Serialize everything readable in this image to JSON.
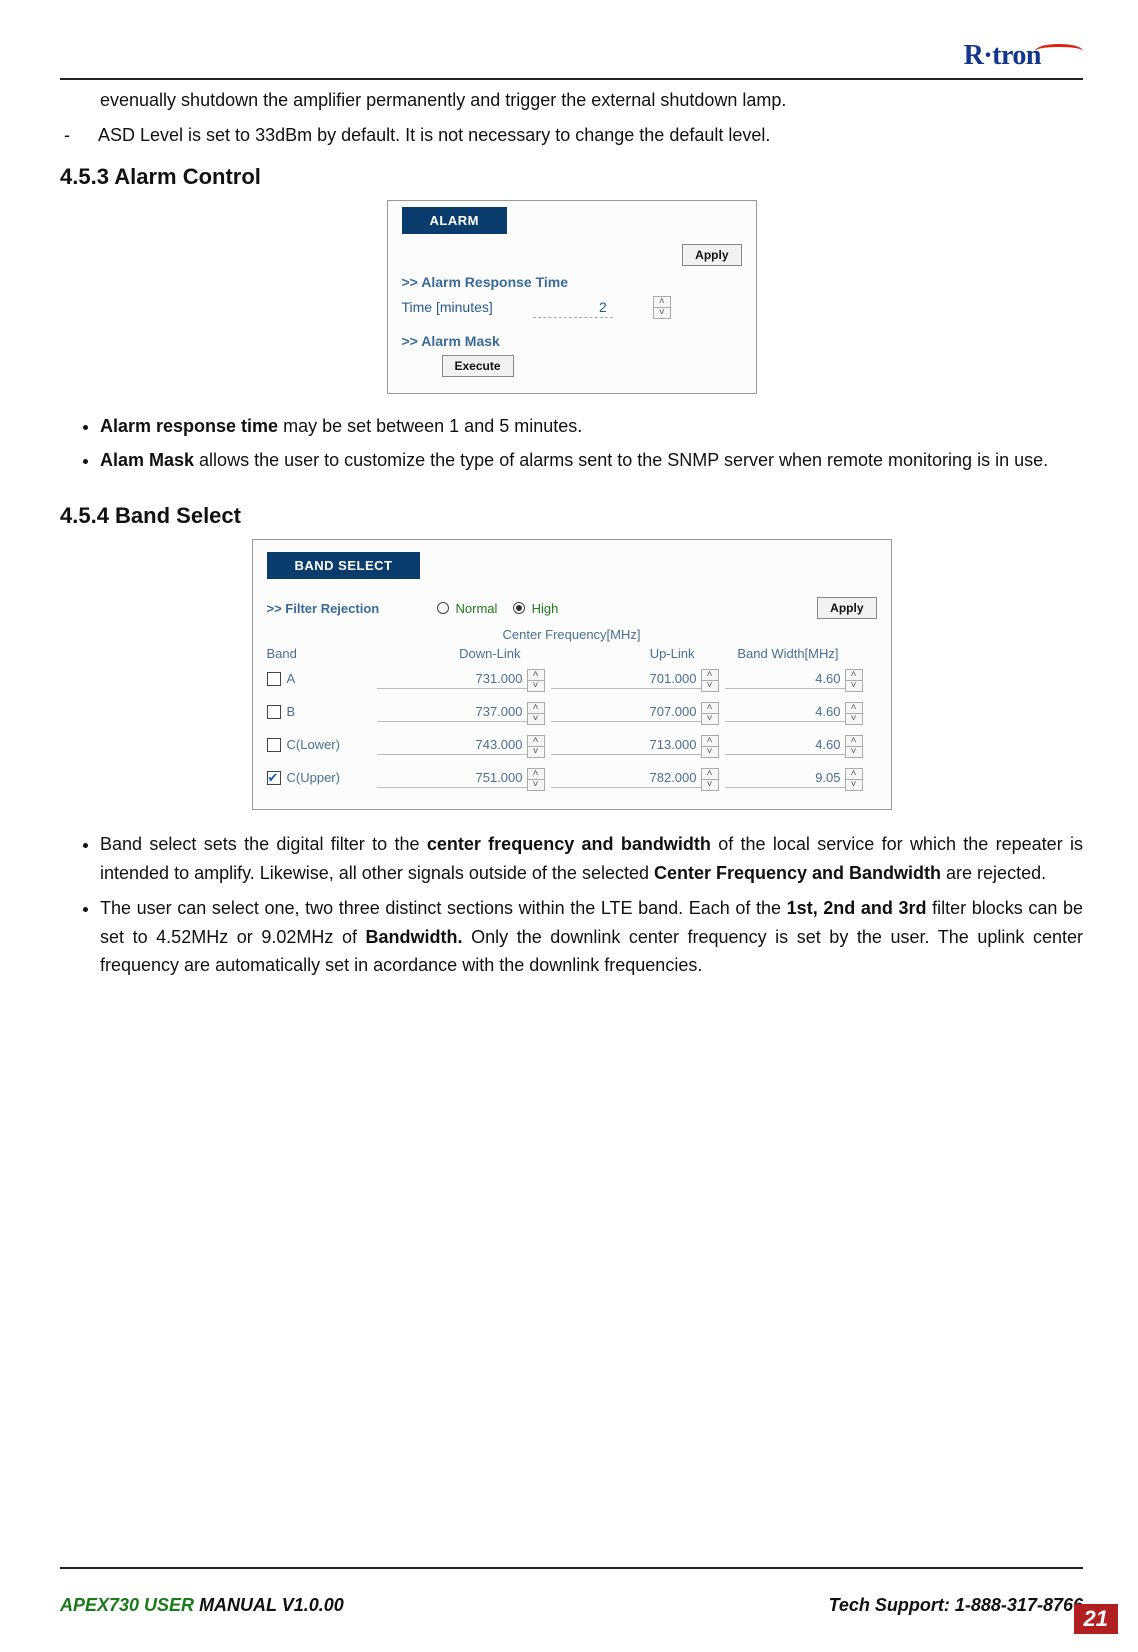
{
  "logo": {
    "text": "R·tron"
  },
  "top_text": {
    "line1": "evenually shutdown the amplifier permanently and trigger the external shutdown lamp.",
    "line2": "ASD Level is set to 33dBm by default. It is not necessary to change the default level."
  },
  "sec453": {
    "heading": "4.5.3 Alarm Control"
  },
  "alarm": {
    "tab": "ALARM",
    "apply": "Apply",
    "sub_resp": ">> Alarm Response Time",
    "time_label": "Time [minutes]",
    "time_value": "2",
    "sub_mask": ">> Alarm Mask",
    "execute": "Execute"
  },
  "bul453": {
    "b1_pre": "Alarm response time",
    "b1_post": " may be set between 1 and 5 minutes.",
    "b2_pre": "Alam Mask",
    "b2_post": " allows the user to customize the type of alarms sent to the SNMP server when remote monitoring is in use."
  },
  "sec454": {
    "heading": "4.5.4 Band Select"
  },
  "band": {
    "tab": "BAND SELECT",
    "filter_label": ">> Filter Rejection",
    "radio_normal": "Normal",
    "radio_high": "High",
    "apply": "Apply",
    "cf_header": "Center Frequency[MHz]",
    "cols": {
      "band": "Band",
      "dl": "Down-Link",
      "ul": "Up-Link",
      "bw": "Band Width[MHz]"
    },
    "rows": [
      {
        "checked": false,
        "label": "A",
        "dl": "731.000",
        "ul": "701.000",
        "bw": "4.60"
      },
      {
        "checked": false,
        "label": "B",
        "dl": "737.000",
        "ul": "707.000",
        "bw": "4.60"
      },
      {
        "checked": false,
        "label": "C(Lower)",
        "dl": "743.000",
        "ul": "713.000",
        "bw": "4.60"
      },
      {
        "checked": true,
        "label": "C(Upper)",
        "dl": "751.000",
        "ul": "782.000",
        "bw": "9.05"
      }
    ]
  },
  "bul454": {
    "b1_a": "Band select sets the digital filter to the ",
    "b1_strong1": "center frequency and bandwidth",
    "b1_b": " of the local service for which the repeater is intended to amplify. Likewise, all other signals outside of the selected ",
    "b1_strong2": "Center Frequency and Bandwidth",
    "b1_c": " are rejected.",
    "b2_a": "The user can select one, two three distinct sections within the LTE band. Each of the ",
    "b2_strong1": "1st, 2nd and 3rd",
    "b2_b": " filter blocks can be set to 4.52MHz or 9.02MHz of ",
    "b2_strong2": "Bandwidth.",
    "b2_c": " Only the downlink center frequency is set by the user. The uplink center frequency are automatically set in acordance with the downlink frequencies."
  },
  "footer": {
    "left_green": "APEX730 USER",
    "left_rest": " MANUAL V1.0.00",
    "right": "Tech Support: 1-888-317-8766",
    "page": "21"
  }
}
